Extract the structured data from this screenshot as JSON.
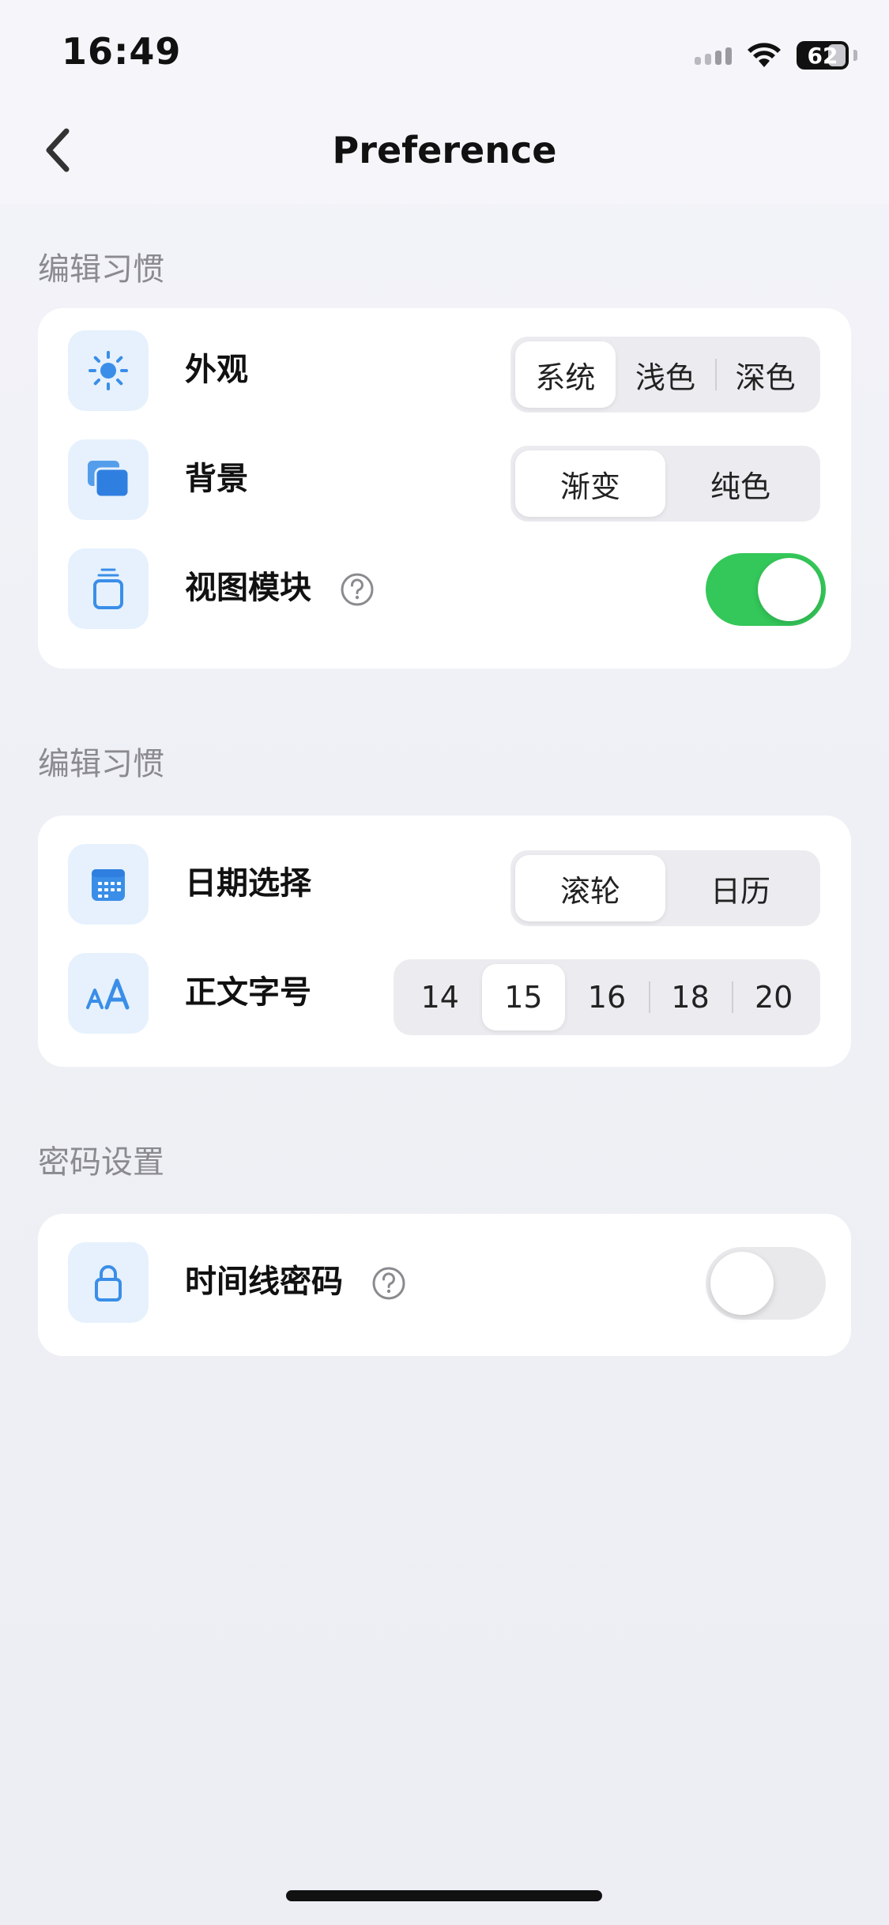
{
  "status_bar": {
    "time": "16:49",
    "battery": "62"
  },
  "nav": {
    "title": "Preference"
  },
  "sections": {
    "editing_1": {
      "title": "编辑习惯",
      "appearance": {
        "label": "外观",
        "options": [
          "系统",
          "浅色",
          "深色"
        ],
        "selected": "系统"
      },
      "background": {
        "label": "背景",
        "options": [
          "渐变",
          "纯色"
        ],
        "selected": "渐变"
      },
      "view_module": {
        "label": "视图模块",
        "enabled": true
      }
    },
    "editing_2": {
      "title": "编辑习惯",
      "date_picker": {
        "label": "日期选择",
        "options": [
          "滚轮",
          "日历"
        ],
        "selected": "滚轮"
      },
      "font_size": {
        "label": "正文字号",
        "options": [
          "14",
          "15",
          "16",
          "18",
          "20"
        ],
        "selected": "15"
      }
    },
    "password": {
      "title": "密码设置",
      "timeline_password": {
        "label": "时间线密码",
        "enabled": false
      }
    }
  },
  "icons": {
    "appearance": "sun-icon",
    "background": "layers-icon",
    "view_module": "widget-icon",
    "date_picker": "calendar-icon",
    "font_size": "text-size-icon",
    "password": "lock-icon",
    "help": "question-icon"
  },
  "colors": {
    "accent": "#3a8ee8",
    "toggle_on": "#34c759",
    "icon_bg": "#e6f1fd",
    "section_title": "#8a8a8f"
  }
}
